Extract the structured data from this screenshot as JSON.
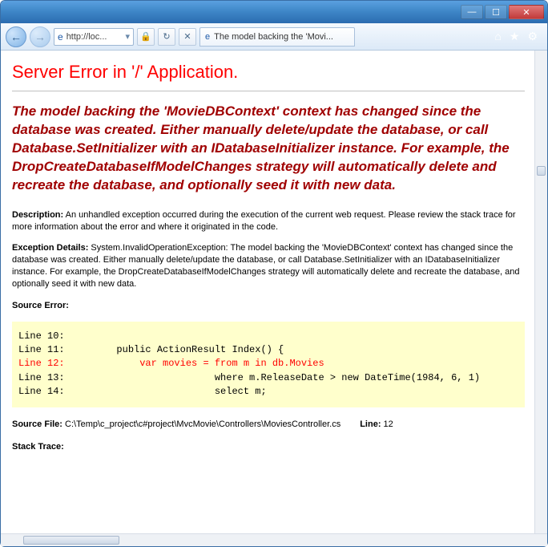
{
  "window": {
    "min": "—",
    "max": "☐",
    "close": "✕"
  },
  "nav": {
    "back": "←",
    "forward": "→",
    "ie_glyph": "e",
    "url": "http://loc...",
    "url_dd": "▾",
    "refresh": "↻",
    "stop": "✕",
    "lock": "🔒"
  },
  "tab": {
    "title": "The model backing the 'Movi..."
  },
  "chrome": {
    "home": "⌂",
    "fav": "★",
    "gear": "⚙"
  },
  "error": {
    "title": "Server Error in '/' Application.",
    "message": "The model backing the 'MovieDBContext' context has changed since the database was created. Either manually delete/update the database, or call Database.SetInitializer with an IDatabaseInitializer instance. For example, the DropCreateDatabaseIfModelChanges strategy will automatically delete and recreate the database, and optionally seed it with new data.",
    "description_label": "Description:",
    "description_text": " An unhandled exception occurred during the execution of the current web request. Please review the stack trace for more information about the error and where it originated in the code.",
    "exception_label": "Exception Details:",
    "exception_text": " System.InvalidOperationException: The model backing the 'MovieDBContext' context has changed since the database was created. Either manually delete/update the database, or call Database.SetInitializer with an IDatabaseInitializer instance. For example, the DropCreateDatabaseIfModelChanges strategy will automatically delete and recreate the database, and optionally seed it with new data.",
    "source_error_label": "Source Error:",
    "code": {
      "l10": "Line 10:",
      "l11": "Line 11:         public ActionResult Index() {",
      "l12": "Line 12:             var movies = from m in db.Movies",
      "l13": "Line 13:                          where m.ReleaseDate > new DateTime(1984, 6, 1)",
      "l14": "Line 14:                          select m;"
    },
    "source_file_label": "Source File:",
    "source_file_path": " C:\\Temp\\c_project\\c#project\\MvcMovie\\Controllers\\MoviesController.cs",
    "line_label": "Line:",
    "line_number": " 12",
    "stack_trace_label": "Stack Trace:"
  }
}
